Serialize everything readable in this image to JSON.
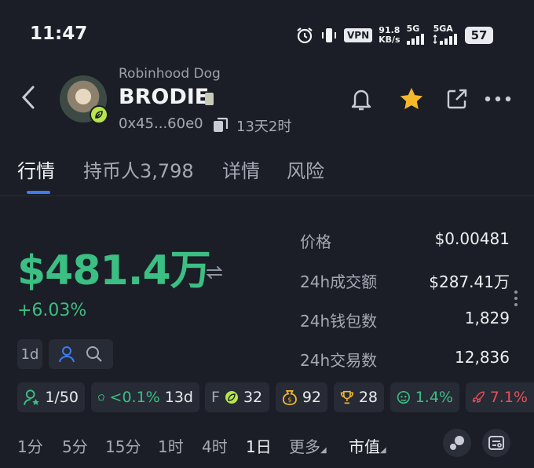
{
  "status_bar": {
    "time": "11:47",
    "vpn": "VPN",
    "speed_value": "91.8",
    "speed_unit": "KB/s",
    "sim1": "5G",
    "sim2": "5GA",
    "battery": "57"
  },
  "token": {
    "subname": "Robinhood Dog",
    "name": "BRODIE",
    "address": "0x45...60e0",
    "age": "13天2时"
  },
  "tabs": [
    {
      "label": "行情"
    },
    {
      "label": "持币人3,798"
    },
    {
      "label": "详情"
    },
    {
      "label": "风险"
    }
  ],
  "market": {
    "market_cap": "$481.4万",
    "change": "+6.03%"
  },
  "stats": [
    {
      "label": "价格",
      "value": "$0.00481"
    },
    {
      "label": "24h成交额",
      "value": "$287.41万"
    },
    {
      "label": "24h钱包数",
      "value": "1,829"
    },
    {
      "label": "24h交易数",
      "value": "12,836"
    }
  ],
  "filter": {
    "period": "1d"
  },
  "chips": {
    "holders_rank": "1/50",
    "top10": "<0.1%",
    "top10_days": "13d",
    "f_label": "F",
    "f_value": "32",
    "bag": "92",
    "trophy": "28",
    "face": "1.4%",
    "rocket": "7.1%"
  },
  "timeframes": [
    {
      "label": "1分"
    },
    {
      "label": "5分"
    },
    {
      "label": "15分"
    },
    {
      "label": "1时"
    },
    {
      "label": "4时"
    },
    {
      "label": "1日"
    },
    {
      "label": "更多"
    },
    {
      "label": "市值"
    }
  ],
  "colors": {
    "background": "#1b1e26",
    "positive": "#3bbf83",
    "accent": "#3d7bf0",
    "star": "#f5b82a",
    "negative": "#e7505a"
  }
}
